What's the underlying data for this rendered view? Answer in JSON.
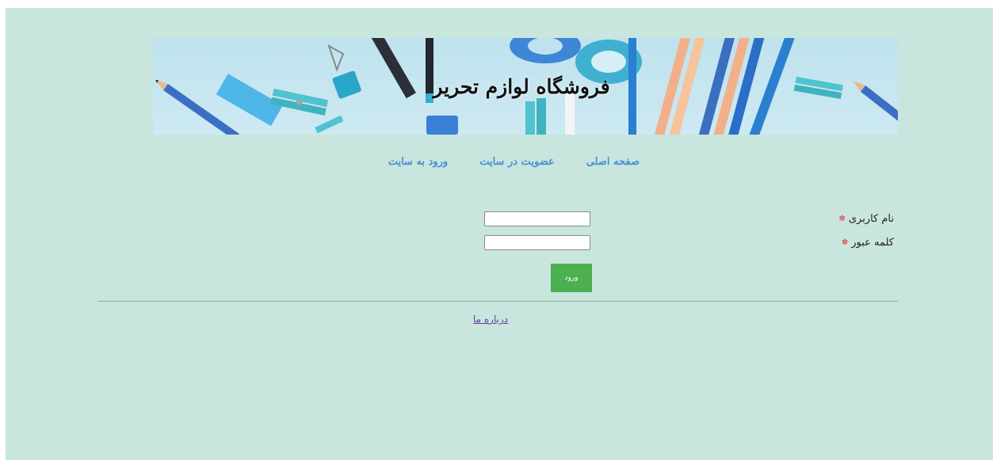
{
  "header": {
    "title": "فروشگاه لوازم تحریر"
  },
  "nav": {
    "items": [
      {
        "label": "صفحه اصلی"
      },
      {
        "label": "عضویت در سایت"
      },
      {
        "label": "ورود به سایت"
      }
    ]
  },
  "login_form": {
    "username_label": "نام کاربری",
    "password_label": "کلمه عبور",
    "required_mark": "✽",
    "username_value": "",
    "password_value": "",
    "submit_label": "ورود"
  },
  "footer": {
    "about_link": "درباره ما"
  },
  "colors": {
    "page_background": "#c8e6de",
    "nav_link": "#4a8fd6",
    "button": "#4caf50",
    "required_mark": "#e05a5a",
    "visited_link": "#5b3f9a"
  }
}
